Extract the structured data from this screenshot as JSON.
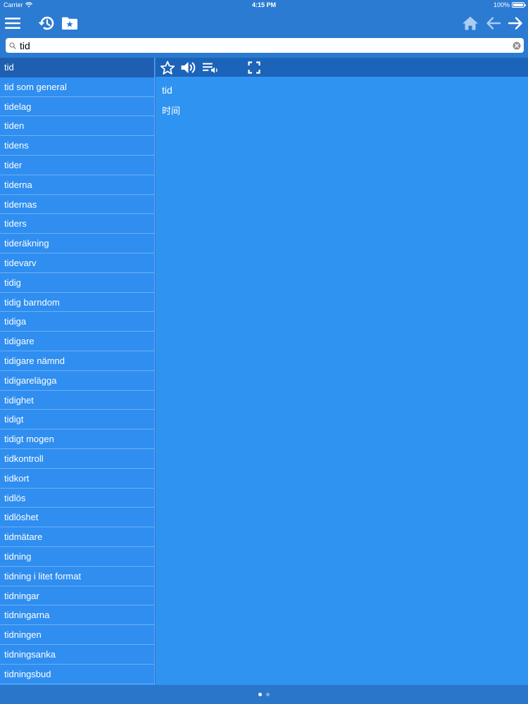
{
  "status_bar": {
    "carrier": "Carrier",
    "time": "4:15 PM",
    "battery": "100%",
    "battery_level": 1.0
  },
  "toolbar": {
    "left_icons": [
      "menu-icon",
      "history-icon",
      "favorites-folder-icon"
    ],
    "right_icons": [
      "home-icon",
      "back-arrow-icon",
      "forward-arrow-icon"
    ]
  },
  "search": {
    "value": "tid",
    "placeholder": ""
  },
  "word_list": {
    "selected_index": 0,
    "items": [
      "tid",
      "tid som general",
      "tidelag",
      "tiden",
      "tidens",
      "tider",
      "tiderna",
      "tidernas",
      "tiders",
      "tideräkning",
      "tidevarv",
      "tidig",
      "tidig barndom",
      "tidiga",
      "tidigare",
      "tidigare nämnd",
      "tidigarelägga",
      "tidighet",
      "tidigt",
      "tidigt mogen",
      "tidkontroll",
      "tidkort",
      "tidlös",
      "tidlöshet",
      "tidmätare",
      "tidning",
      "tidning i litet format",
      "tidningar",
      "tidningarna",
      "tidningen",
      "tidningsanka",
      "tidningsbud"
    ]
  },
  "detail": {
    "toolbar_icons": [
      "star-icon",
      "speaker-icon",
      "playlist-audio-icon",
      "fullscreen-icon"
    ],
    "word": "tid",
    "translation": "时间"
  },
  "page_indicator": {
    "count": 2,
    "active": 0
  },
  "colors": {
    "toolbar_bg": "#2b7bd2",
    "list_bg": "#2f8ef0",
    "selected_row": "#1e5fb2",
    "detail_bg": "#2f93f2",
    "icon_white": "#ffffff",
    "icon_light_blue": "#a9cdf3"
  }
}
